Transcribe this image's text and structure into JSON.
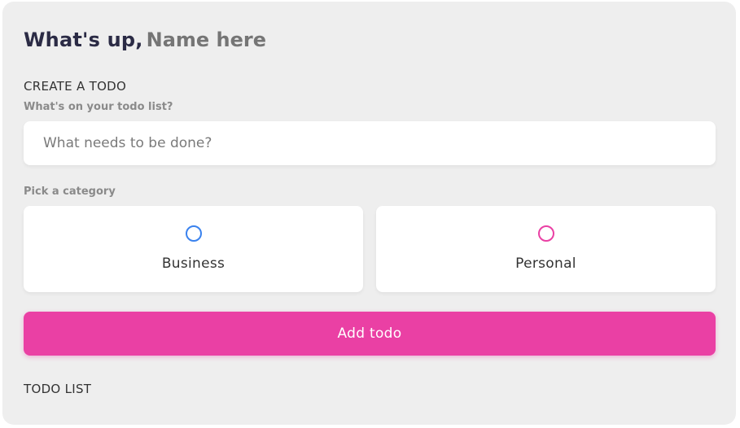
{
  "greeting": {
    "prefix": "What's up,",
    "name_placeholder": "Name here"
  },
  "create": {
    "heading": "CREATE A TODO",
    "input_label": "What's on your todo list?",
    "input_placeholder": "What needs to be done?",
    "input_value": ""
  },
  "category": {
    "label": "Pick a category",
    "options": [
      {
        "label": "Business",
        "color": "#3a82ee"
      },
      {
        "label": "Personal",
        "color": "#ea40a4"
      }
    ]
  },
  "add_button": {
    "label": "Add todo",
    "color": "#ea40a4"
  },
  "todo_list": {
    "heading": "TODO LIST"
  }
}
